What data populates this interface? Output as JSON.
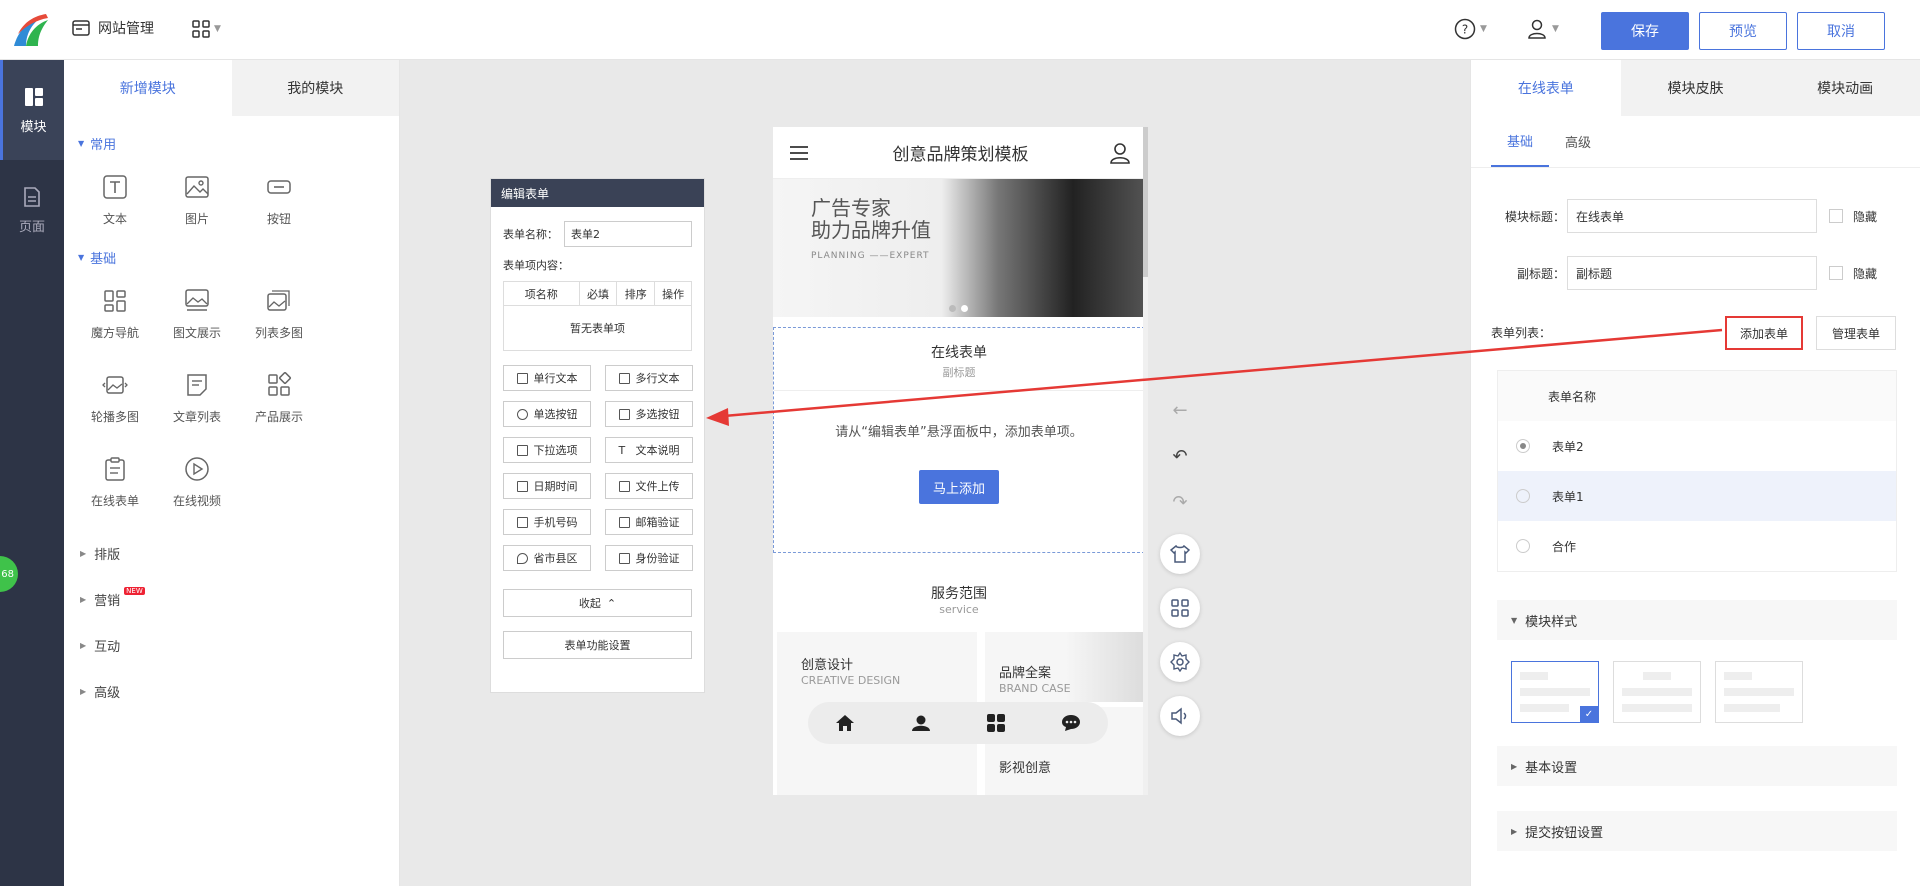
{
  "topbar": {
    "site_mgmt": "网站管理",
    "save": "保存",
    "preview": "预览",
    "cancel": "取消"
  },
  "leftnav": [
    {
      "label": "模块",
      "icon": "module-icon"
    },
    {
      "label": "页面",
      "icon": "page-icon"
    }
  ],
  "modpanel": {
    "tabs": [
      "新增模块",
      "我的模块"
    ],
    "common_title": "常用",
    "common": [
      "文本",
      "图片",
      "按钮"
    ],
    "basic_title": "基础",
    "basic": [
      "魔方导航",
      "图文展示",
      "列表多图",
      "轮播多图",
      "文章列表",
      "产品展示",
      "在线表单",
      "在线视频"
    ],
    "collapsed": [
      "排版",
      "营销",
      "互动",
      "高级"
    ],
    "new_badge": "NEW",
    "badge_count": "68"
  },
  "editform": {
    "title": "编辑表单",
    "name_label": "表单名称：",
    "name_value": "表单2",
    "items_label": "表单项内容：",
    "cols": [
      "项名称",
      "必填",
      "排序",
      "操作"
    ],
    "empty": "暂无表单项",
    "buttons": [
      "单行文本",
      "多行文本",
      "单选按钮",
      "多选按钮",
      "下拉选项",
      "文本说明",
      "日期时间",
      "文件上传",
      "手机号码",
      "邮箱验证",
      "省市县区",
      "身份验证"
    ],
    "collapse": "收起",
    "settings": "表单功能设置"
  },
  "phone": {
    "title": "创意品牌策划模板",
    "banner_line1": "广告专家",
    "banner_line2": "助力品牌升值",
    "banner_en": "PLANNING ——EXPERT",
    "form_title": "在线表单",
    "form_subtitle": "副标题",
    "form_hint": "请从“编辑表单”悬浮面板中，添加表单项。",
    "form_add": "马上添加",
    "serv_title": "服务范围",
    "serv_sub": "service",
    "cards": [
      {
        "a": "创意设计",
        "b": "CREATIVE DESIGN"
      },
      {
        "a": "品牌全案",
        "b": "BRAND CASE"
      },
      {
        "a": "影视创意",
        "b": ""
      }
    ]
  },
  "rpanel": {
    "tabs": [
      "在线表单",
      "模块皮肤",
      "模块动画"
    ],
    "subtabs": [
      "基础",
      "高级"
    ],
    "title_label": "模块标题：",
    "title_value": "在线表单",
    "hide": "隐藏",
    "subtitle_label": "副标题：",
    "subtitle_value": "副标题",
    "list_label": "表单列表：",
    "add_form": "添加表单",
    "manage_form": "管理表单",
    "list_header": "表单名称",
    "forms": [
      "表单2",
      "表单1",
      "合作"
    ],
    "acc_style": "模块样式",
    "acc_basic": "基本设置",
    "acc_submit": "提交按钮设置"
  },
  "colors": {
    "accent": "#4a74dd",
    "highlight": "#e53935",
    "sidebar": "#2d3446"
  }
}
